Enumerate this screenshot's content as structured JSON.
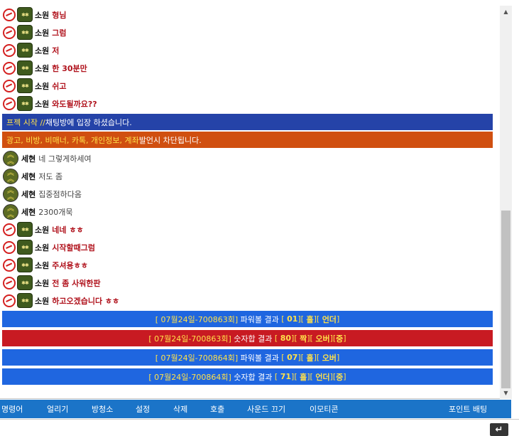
{
  "chat": {
    "messages": [
      {
        "user": "소원",
        "text": "형님"
      },
      {
        "user": "소원",
        "text": "그럼"
      },
      {
        "user": "소원",
        "text": "저"
      },
      {
        "user": "소원",
        "text": "한 30분만"
      },
      {
        "user": "소원",
        "text": "쉬고"
      },
      {
        "user": "소원",
        "text": "와도될까요??"
      }
    ],
    "notice1": {
      "prefix": "프젝 시작 // ",
      "text": "채팅방에 입장 하셨습니다."
    },
    "notice2": {
      "prefix": "광고, 비방, 비매너, 카톡, 개인정보, 계좌",
      "text": " 발언시 차단됩니다."
    },
    "messages2": [
      {
        "user": "세현",
        "text": "네 그렇게하세여"
      },
      {
        "user": "세현",
        "text": "저도 좀"
      },
      {
        "user": "세현",
        "text": "집중점하다옴"
      },
      {
        "user": "세현",
        "text": "2300개묵"
      }
    ],
    "messages3": [
      {
        "user": "소원",
        "text": "네네 ㅎㅎ"
      },
      {
        "user": "소원",
        "text": "시작할때그럼"
      },
      {
        "user": "소원",
        "text": "주셔용ㅎㅎ"
      },
      {
        "user": "소원",
        "text": "전 좀 사워한판"
      },
      {
        "user": "소원",
        "text": "하고오겠습니다 ㅎㅎ"
      }
    ],
    "rank_badge_text": "✱✱",
    "results": [
      {
        "round": "[ 07월24일-700863회]",
        "game": "파워볼 결과",
        "num": "01",
        "r1": "홀",
        "r2": "언더",
        "r3": ""
      },
      {
        "round": "[ 07월24일-700863회]",
        "game": "숫자합 결과",
        "num": "80",
        "r1": "짝",
        "r2": "오버",
        "r3": "중"
      },
      {
        "round": "[ 07월24일-700864회]",
        "game": "파워볼 결과",
        "num": "07",
        "r1": "홀",
        "r2": "오버",
        "r3": ""
      },
      {
        "round": "[ 07월24일-700864회]",
        "game": "숫자합 결과",
        "num": "71",
        "r1": "홀",
        "r2": "언더",
        "r3": "중"
      }
    ]
  },
  "menu": {
    "commands": "명령어",
    "freeze": "얼리기",
    "clean": "방청소",
    "settings": "설정",
    "delete": "삭제",
    "call": "호출",
    "sound_off": "사운드 끄기",
    "emoticon": "이모티콘",
    "point_bet": "포인트 배팅"
  },
  "input": {
    "send_icon": "↵"
  },
  "colors": {
    "menu_bg": "#1b74c8",
    "notice_blue": "#2543a8",
    "notice_orange": "#d04f10",
    "result_blue": "#1f66e0",
    "result_red": "#c81a22"
  },
  "icons": {
    "badge": "anti-symbol-icon",
    "rank_green": "military-rank-icon",
    "rank_chevron": "sergeant-chevron-icon"
  }
}
